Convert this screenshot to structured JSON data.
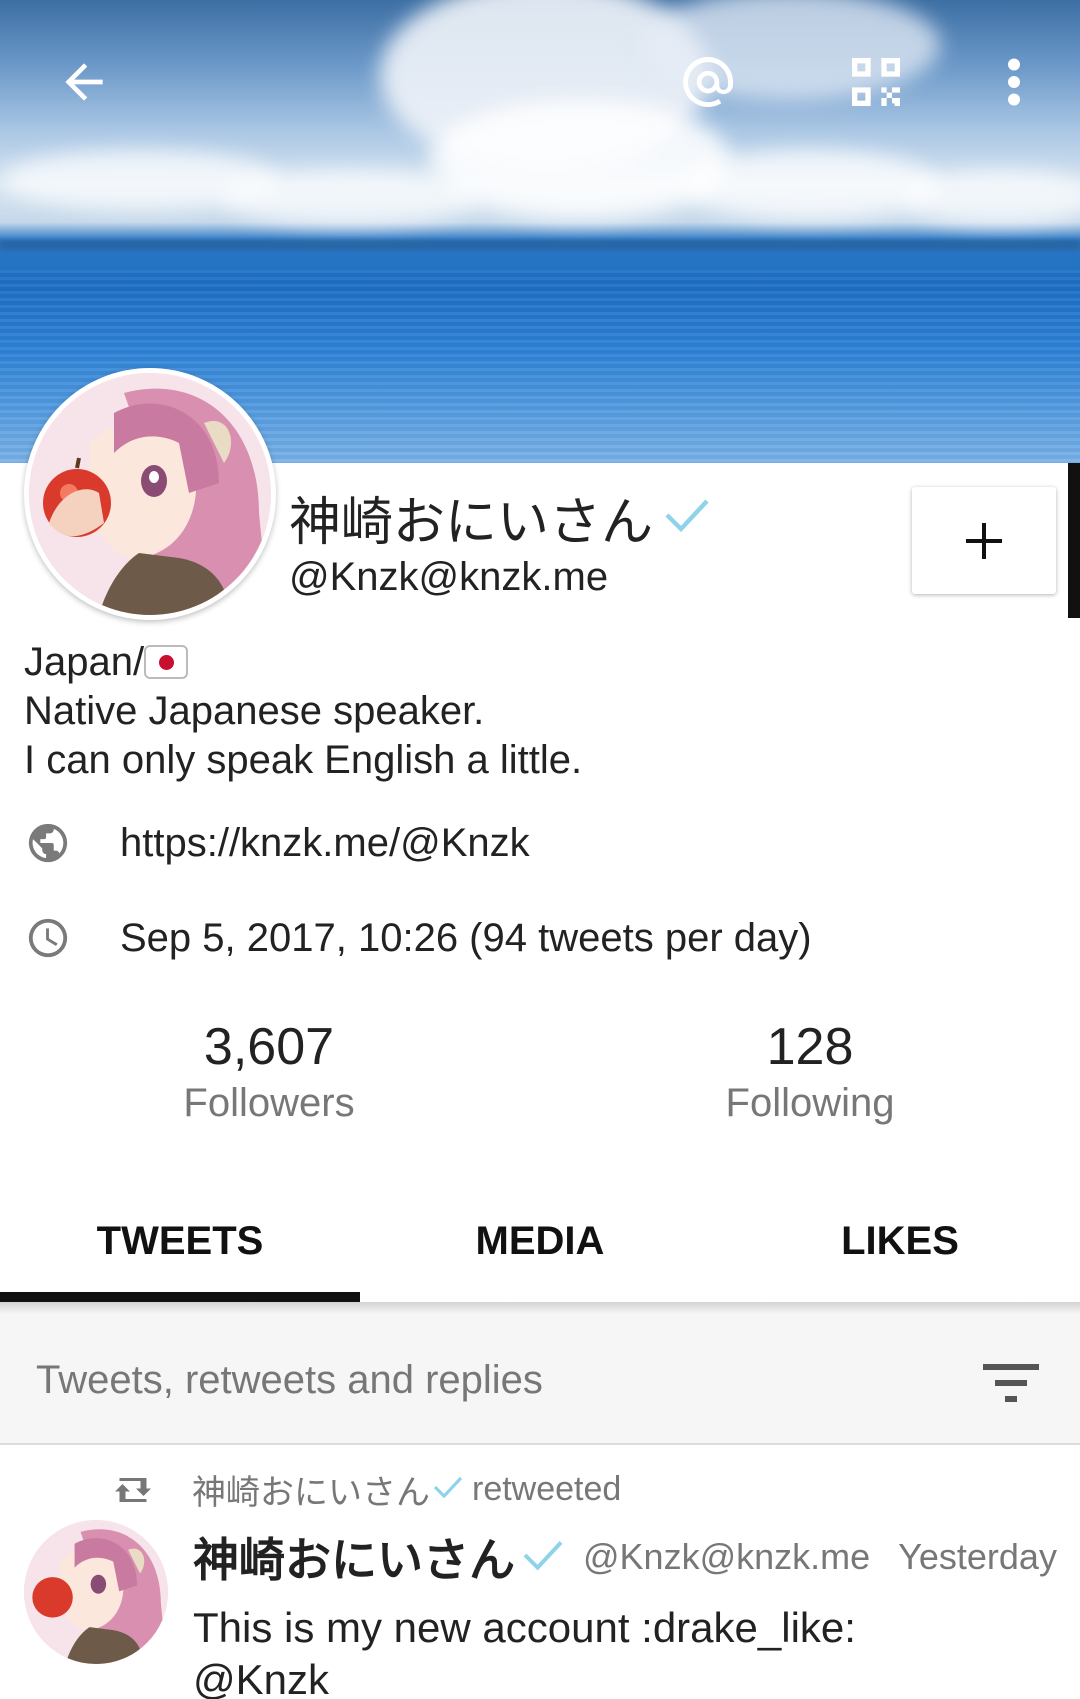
{
  "header": {
    "back_icon": "arrow-left-icon",
    "mention_icon": "at-sign-icon",
    "qr_icon": "qr-code-icon",
    "menu_icon": "more-vertical-icon"
  },
  "profile": {
    "display_name": "神崎おにいさん",
    "acct": "@Knzk@knzk.me",
    "verified_icon": "verified-check-icon",
    "follow_label": "+",
    "bio": {
      "line1": "Japan/",
      "line1_emoji": "japan-flag-emoji",
      "line2": "Native Japanese speaker.",
      "line3": "I can only speak English a little."
    },
    "website": "https://knzk.me/@Knzk",
    "joined": "Sep 5, 2017, 10:26 (94 tweets per day)",
    "stats": {
      "followers_count": "3,607",
      "followers_label": "Followers",
      "following_count": "128",
      "following_label": "Following"
    }
  },
  "tabs": [
    {
      "label": "TWEETS",
      "active": true
    },
    {
      "label": "MEDIA",
      "active": false
    },
    {
      "label": "LIKES",
      "active": false
    }
  ],
  "filter": {
    "label": "Tweets, retweets and replies",
    "icon": "filter-icon"
  },
  "timeline": [
    {
      "retweeted_by": "神崎おにいさん",
      "retweeted_suffix": "retweeted",
      "name": "神崎おにいさん",
      "acct": "@Knzk@knzk.me",
      "time": "Yesterday",
      "text_line1": "This is my new account :drake_like:",
      "text_line2": "@Knzk"
    }
  ],
  "colors": {
    "accent": "#111111",
    "verified": "#5bc0de",
    "secondary_text": "#777777"
  }
}
